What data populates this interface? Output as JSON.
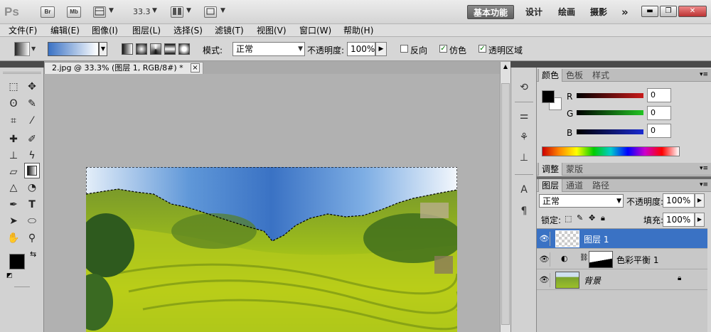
{
  "appbar": {
    "logo": "Ps",
    "br": "Br",
    "mb": "Mb",
    "zoom": "33.3",
    "workspaces": [
      "基本功能",
      "设计",
      "绘画",
      "摄影"
    ],
    "more": "»"
  },
  "menu": [
    "文件(F)",
    "编辑(E)",
    "图像(I)",
    "图层(L)",
    "选择(S)",
    "滤镜(T)",
    "视图(V)",
    "窗口(W)",
    "帮助(H)"
  ],
  "options": {
    "mode_label": "模式:",
    "mode_value": "正常",
    "opacity_label": "不透明度:",
    "opacity_value": "100%",
    "reverse_label": "反向",
    "reverse_checked": false,
    "dither_label": "仿色",
    "dither_checked": true,
    "transparency_label": "透明区域",
    "transparency_checked": true
  },
  "document": {
    "tab_title": "2.jpg @ 33.3% (图层 1, RGB/8#) *",
    "close": "×"
  },
  "color_panel": {
    "tabs": [
      "颜色",
      "色板",
      "样式"
    ],
    "r_label": "R",
    "g_label": "G",
    "b_label": "B",
    "r_value": "0",
    "g_value": "0",
    "b_value": "0",
    "colors": {
      "red": "#c81a1a",
      "green": "#22c422",
      "blue": "#1a2ad0"
    }
  },
  "adjust_panel": {
    "tabs": [
      "调整",
      "蒙版"
    ]
  },
  "layers_panel": {
    "tabs": [
      "图层",
      "通道",
      "路径"
    ],
    "blend_mode": "正常",
    "opacity_label": "不透明度:",
    "opacity_value": "100%",
    "lock_label": "锁定:",
    "fill_label": "填充:",
    "fill_value": "100%",
    "layers": [
      {
        "name": "图层 1",
        "selected": true
      },
      {
        "name": "色彩平衡 1",
        "selected": false
      },
      {
        "name": "背景",
        "selected": false
      }
    ]
  },
  "accent": "#3a72c4"
}
